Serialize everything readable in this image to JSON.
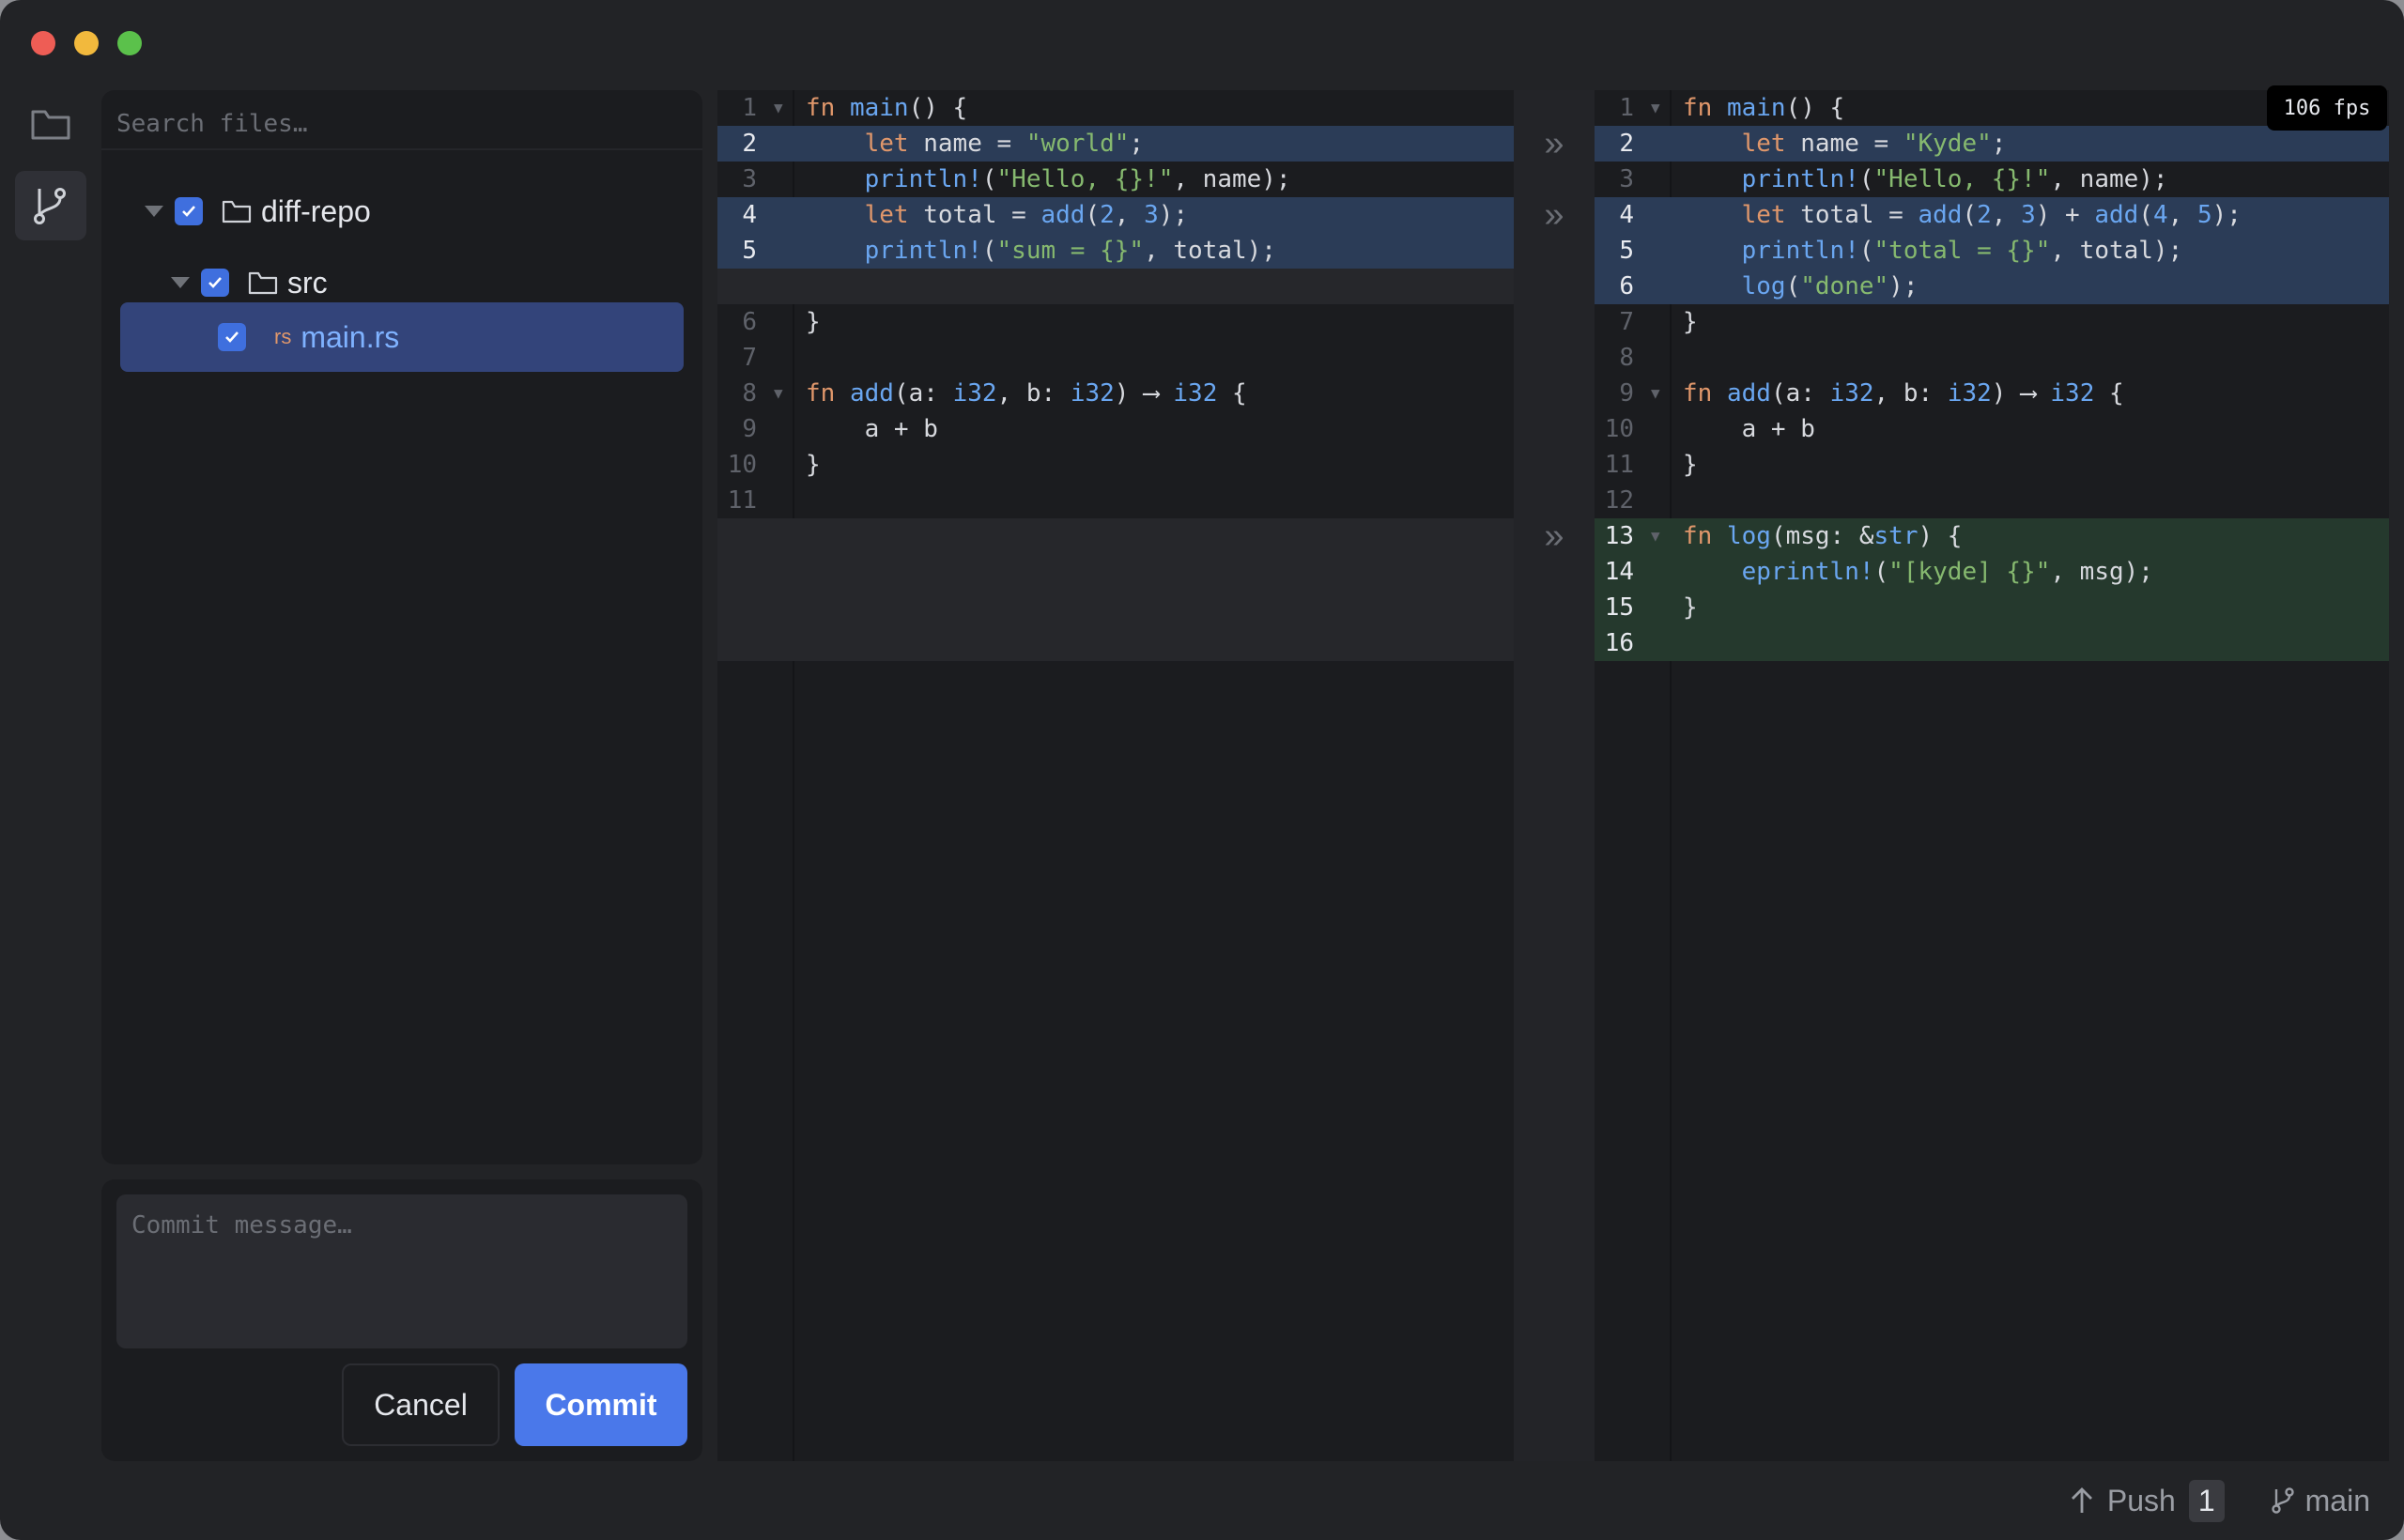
{
  "window": {
    "traffic_lights": {
      "close": "#ee5d55",
      "minimize": "#f2b93d",
      "maximize": "#5bc14b"
    }
  },
  "sidebar": {
    "rail": [
      {
        "name": "files",
        "icon": "folder-icon"
      },
      {
        "name": "source-control",
        "icon": "git-branch-icon",
        "active": true
      }
    ],
    "search_placeholder": "Search files…",
    "tree": [
      {
        "label": "diff-repo",
        "type": "folder",
        "checked": true
      },
      {
        "label": "src",
        "type": "folder",
        "checked": true
      },
      {
        "label": "main.rs",
        "type": "file",
        "badge": "rs",
        "checked": true,
        "selected": true
      }
    ],
    "commit": {
      "placeholder": "Commit message…",
      "cancel_label": "Cancel",
      "commit_label": "Commit"
    }
  },
  "diff": {
    "fps": "106 fps",
    "left": [
      {
        "n": "1",
        "kind": "ctx",
        "fold": true,
        "segs": [
          [
            "kw",
            "fn "
          ],
          [
            "fn",
            "main"
          ],
          [
            "",
            "() {"
          ]
        ]
      },
      {
        "n": "2",
        "kind": "mod",
        "segs": [
          [
            "",
            "    "
          ],
          [
            "kw",
            "let"
          ],
          [
            "",
            " name = "
          ],
          [
            "st",
            "\"world\""
          ],
          [
            "",
            ";"
          ]
        ]
      },
      {
        "n": "3",
        "kind": "ctx",
        "segs": [
          [
            "",
            "    "
          ],
          [
            "fn",
            "println!"
          ],
          [
            "",
            "("
          ],
          [
            "st",
            "\"Hello, {}!\""
          ],
          [
            "",
            ", name);"
          ]
        ]
      },
      {
        "n": "4",
        "kind": "mod",
        "segs": [
          [
            "",
            "    "
          ],
          [
            "kw",
            "let"
          ],
          [
            "",
            " total = "
          ],
          [
            "fn",
            "add"
          ],
          [
            "",
            "("
          ],
          [
            "nu",
            "2"
          ],
          [
            "",
            ", "
          ],
          [
            "nu",
            "3"
          ],
          [
            "",
            ");"
          ]
        ]
      },
      {
        "n": "5",
        "kind": "mod",
        "segs": [
          [
            "",
            "    "
          ],
          [
            "fn",
            "println!"
          ],
          [
            "",
            "("
          ],
          [
            "st",
            "\"sum = {}\""
          ],
          [
            "",
            ", total);"
          ]
        ]
      },
      {
        "n": "",
        "kind": "gap",
        "segs": []
      },
      {
        "n": "6",
        "kind": "ctx",
        "segs": [
          [
            "",
            "}"
          ]
        ]
      },
      {
        "n": "7",
        "kind": "ctx",
        "segs": []
      },
      {
        "n": "8",
        "kind": "ctx",
        "fold": true,
        "segs": [
          [
            "kw",
            "fn "
          ],
          [
            "fn",
            "add"
          ],
          [
            "",
            "(a: "
          ],
          [
            "ty",
            "i32"
          ],
          [
            "",
            ", b: "
          ],
          [
            "ty",
            "i32"
          ],
          [
            "",
            ") ⟶ "
          ],
          [
            "ty",
            "i32"
          ],
          [
            "",
            " {"
          ]
        ]
      },
      {
        "n": "9",
        "kind": "ctx",
        "segs": [
          [
            "",
            "    a + b"
          ]
        ]
      },
      {
        "n": "10",
        "kind": "ctx",
        "segs": [
          [
            "",
            "}"
          ]
        ]
      },
      {
        "n": "11",
        "kind": "ctx",
        "segs": []
      },
      {
        "n": "",
        "kind": "gap",
        "segs": []
      },
      {
        "n": "",
        "kind": "gap",
        "segs": []
      },
      {
        "n": "",
        "kind": "gap",
        "segs": []
      },
      {
        "n": "",
        "kind": "gap",
        "segs": []
      }
    ],
    "right": [
      {
        "n": "1",
        "kind": "ctx",
        "fold": true,
        "segs": [
          [
            "kw",
            "fn "
          ],
          [
            "fn",
            "main"
          ],
          [
            "",
            "() {"
          ]
        ]
      },
      {
        "n": "2",
        "kind": "mod",
        "segs": [
          [
            "",
            "    "
          ],
          [
            "kw",
            "let"
          ],
          [
            "",
            " name = "
          ],
          [
            "st",
            "\"Kyde\""
          ],
          [
            "",
            ";"
          ]
        ]
      },
      {
        "n": "3",
        "kind": "ctx",
        "segs": [
          [
            "",
            "    "
          ],
          [
            "fn",
            "println!"
          ],
          [
            "",
            "("
          ],
          [
            "st",
            "\"Hello, {}!\""
          ],
          [
            "",
            ", name);"
          ]
        ]
      },
      {
        "n": "4",
        "kind": "mod",
        "segs": [
          [
            "",
            "    "
          ],
          [
            "kw",
            "let"
          ],
          [
            "",
            " total = "
          ],
          [
            "fn",
            "add"
          ],
          [
            "",
            "("
          ],
          [
            "nu",
            "2"
          ],
          [
            "",
            ", "
          ],
          [
            "nu",
            "3"
          ],
          [
            "",
            ") + "
          ],
          [
            "fn",
            "add"
          ],
          [
            "",
            "("
          ],
          [
            "nu",
            "4"
          ],
          [
            "",
            ", "
          ],
          [
            "nu",
            "5"
          ],
          [
            "",
            ");"
          ]
        ]
      },
      {
        "n": "5",
        "kind": "mod",
        "segs": [
          [
            "",
            "    "
          ],
          [
            "fn",
            "println!"
          ],
          [
            "",
            "("
          ],
          [
            "st",
            "\"total = {}\""
          ],
          [
            "",
            ", total);"
          ]
        ]
      },
      {
        "n": "6",
        "kind": "mod",
        "segs": [
          [
            "",
            "    "
          ],
          [
            "fn",
            "log"
          ],
          [
            "",
            "("
          ],
          [
            "st",
            "\"done\""
          ],
          [
            "",
            ");"
          ]
        ]
      },
      {
        "n": "7",
        "kind": "ctx",
        "segs": [
          [
            "",
            "}"
          ]
        ]
      },
      {
        "n": "8",
        "kind": "ctx",
        "segs": []
      },
      {
        "n": "9",
        "kind": "ctx",
        "fold": true,
        "segs": [
          [
            "kw",
            "fn "
          ],
          [
            "fn",
            "add"
          ],
          [
            "",
            "(a: "
          ],
          [
            "ty",
            "i32"
          ],
          [
            "",
            ", b: "
          ],
          [
            "ty",
            "i32"
          ],
          [
            "",
            ") ⟶ "
          ],
          [
            "ty",
            "i32"
          ],
          [
            "",
            " {"
          ]
        ]
      },
      {
        "n": "10",
        "kind": "ctx",
        "segs": [
          [
            "",
            "    a + b"
          ]
        ]
      },
      {
        "n": "11",
        "kind": "ctx",
        "segs": [
          [
            "",
            "}"
          ]
        ]
      },
      {
        "n": "12",
        "kind": "ctx",
        "segs": []
      },
      {
        "n": "13",
        "kind": "add",
        "fold": true,
        "segs": [
          [
            "kw",
            "fn "
          ],
          [
            "fn",
            "log"
          ],
          [
            "",
            "(msg: &"
          ],
          [
            "ty",
            "str"
          ],
          [
            "",
            ") {"
          ]
        ]
      },
      {
        "n": "14",
        "kind": "add",
        "segs": [
          [
            "",
            "    "
          ],
          [
            "fn",
            "eprintln!"
          ],
          [
            "",
            "("
          ],
          [
            "st",
            "\"[kyde] {}\""
          ],
          [
            "",
            ", msg);"
          ]
        ]
      },
      {
        "n": "15",
        "kind": "add",
        "segs": [
          [
            "",
            "}"
          ]
        ]
      },
      {
        "n": "16",
        "kind": "add",
        "segs": []
      }
    ],
    "arrows": [
      "»",
      "»",
      "»"
    ]
  },
  "status": {
    "push_label": "Push",
    "push_count": "1",
    "branch": "main"
  }
}
